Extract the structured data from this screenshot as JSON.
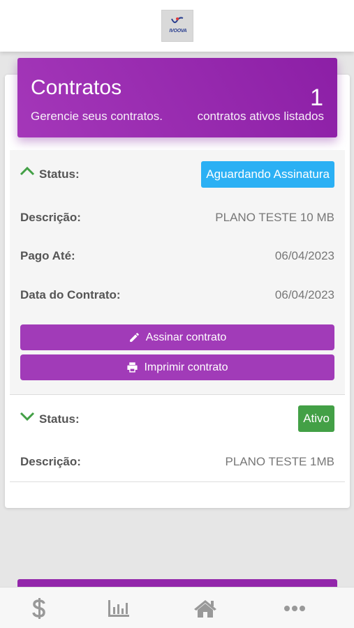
{
  "logo": {
    "text": "IVOOVA"
  },
  "header": {
    "title": "Contratos",
    "subtitle": "Gerencie seus contratos.",
    "count": "1",
    "count_label": "contratos ativos listados"
  },
  "contracts": [
    {
      "expanded": true,
      "status_label": "Status:",
      "status": "Aguardando Assinatura",
      "status_color": "#2bb0f4",
      "descricao_label": "Descrição:",
      "descricao": "PLANO TESTE 10 MB",
      "pago_label": "Pago Até:",
      "pago": "06/04/2023",
      "data_label": "Data do Contrato:",
      "data": "06/04/2023",
      "sign_button": "Assinar contrato",
      "print_button": "Imprimir contrato"
    },
    {
      "expanded": false,
      "status_label": "Status:",
      "status": "Ativo",
      "status_color": "#43a046",
      "descricao_label": "Descrição:",
      "descricao": "PLANO TESTE 1MB"
    }
  ],
  "nav": {
    "items": [
      "dollar-icon",
      "chart-icon",
      "home-icon",
      "more-icon"
    ]
  },
  "colors": {
    "accent": "#a13bb8",
    "chevron": "#43a046"
  }
}
